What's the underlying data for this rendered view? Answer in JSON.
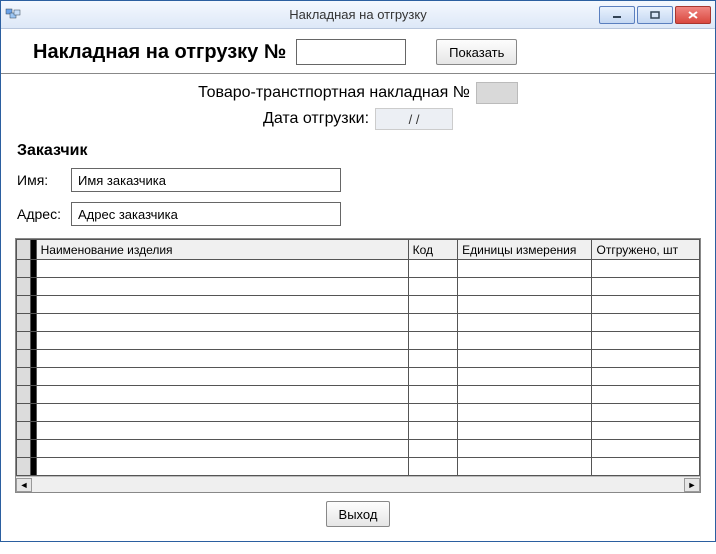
{
  "window": {
    "title": "Накладная на отгрузку"
  },
  "header": {
    "label": "Накладная на отгрузку №",
    "number_value": "",
    "show_button": "Показать"
  },
  "sub": {
    "ttn_label": "Товаро-транстпортная накладная №",
    "ttn_value": "",
    "date_label": "Дата отгрузки:",
    "date_value": "/ /"
  },
  "customer": {
    "section_title": "Заказчик",
    "name_label": "Имя:",
    "name_value": "Имя заказчика",
    "addr_label": "Адрес:",
    "addr_value": "Адрес заказчика"
  },
  "grid": {
    "columns": [
      "Наименование изделия",
      "Код",
      "Единицы измерения",
      "Отгружено, шт"
    ],
    "rows": [
      [
        "",
        "",
        "",
        ""
      ],
      [
        "",
        "",
        "",
        ""
      ],
      [
        "",
        "",
        "",
        ""
      ],
      [
        "",
        "",
        "",
        ""
      ],
      [
        "",
        "",
        "",
        ""
      ],
      [
        "",
        "",
        "",
        ""
      ],
      [
        "",
        "",
        "",
        ""
      ],
      [
        "",
        "",
        "",
        ""
      ],
      [
        "",
        "",
        "",
        ""
      ],
      [
        "",
        "",
        "",
        ""
      ],
      [
        "",
        "",
        "",
        ""
      ],
      [
        "",
        "",
        "",
        ""
      ]
    ]
  },
  "footer": {
    "exit_button": "Выход"
  }
}
